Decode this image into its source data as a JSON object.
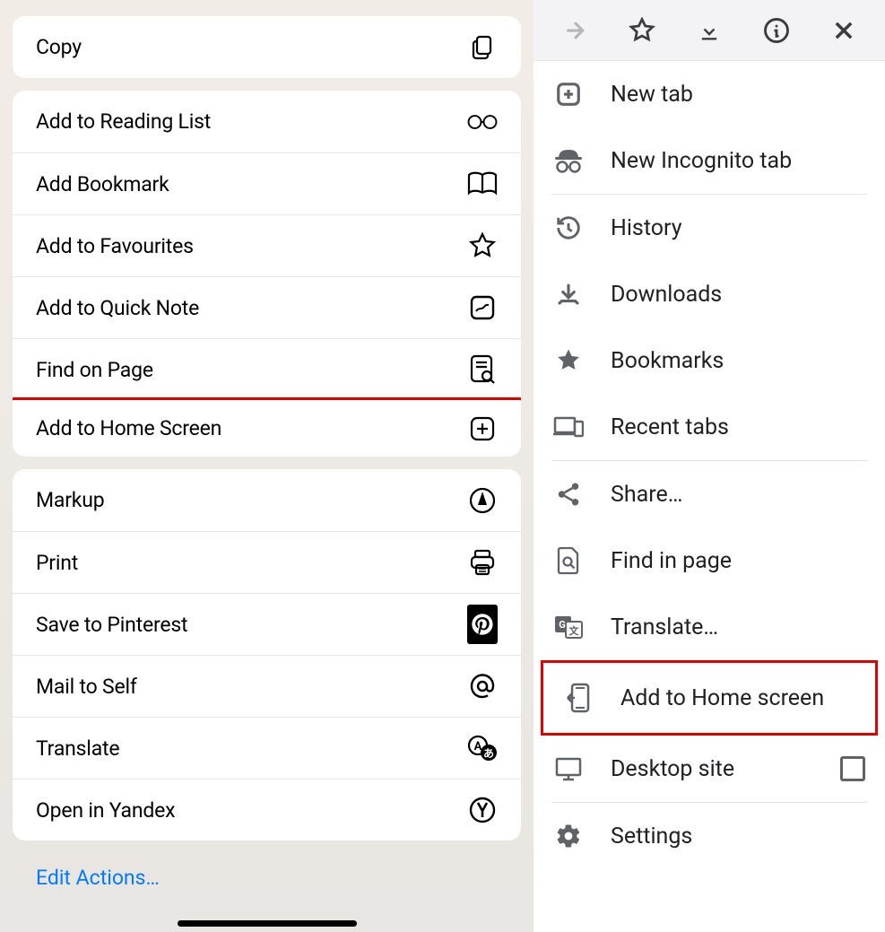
{
  "ios": {
    "group0": [
      {
        "label": "Copy",
        "icon": "copy"
      }
    ],
    "group1": [
      {
        "label": "Add to Reading List",
        "icon": "glasses"
      },
      {
        "label": "Add Bookmark",
        "icon": "book"
      },
      {
        "label": "Add to Favourites",
        "icon": "star"
      },
      {
        "label": "Add to Quick Note",
        "icon": "quicknote"
      },
      {
        "label": "Find on Page",
        "icon": "findpage"
      },
      {
        "label": "Add to Home Screen",
        "icon": "plusbox",
        "highlight": true
      }
    ],
    "group2": [
      {
        "label": "Markup",
        "icon": "markup"
      },
      {
        "label": "Print",
        "icon": "print"
      },
      {
        "label": "Save to Pinterest",
        "icon": "pinterest"
      },
      {
        "label": "Mail to Self",
        "icon": "at"
      },
      {
        "label": "Translate",
        "icon": "translate"
      },
      {
        "label": "Open in Yandex",
        "icon": "yandex"
      }
    ],
    "editActions": "Edit Actions…"
  },
  "chrome": {
    "toolbar": [
      "forward",
      "star",
      "download",
      "info",
      "close"
    ],
    "menu": [
      [
        {
          "label": "New tab",
          "icon": "newtab"
        },
        {
          "label": "New Incognito tab",
          "icon": "incognito"
        }
      ],
      [
        {
          "label": "History",
          "icon": "history"
        },
        {
          "label": "Downloads",
          "icon": "download2"
        },
        {
          "label": "Bookmarks",
          "icon": "starfill"
        },
        {
          "label": "Recent tabs",
          "icon": "devices"
        }
      ],
      [
        {
          "label": "Share…",
          "icon": "share"
        },
        {
          "label": "Find in page",
          "icon": "findinpage"
        },
        {
          "label": "Translate…",
          "icon": "gtranslate"
        },
        {
          "label": "Add to Home screen",
          "icon": "addhome",
          "highlight": true
        },
        {
          "label": "Desktop site",
          "icon": "desktop",
          "checkbox": true
        }
      ],
      [
        {
          "label": "Settings",
          "icon": "settings"
        }
      ]
    ]
  }
}
